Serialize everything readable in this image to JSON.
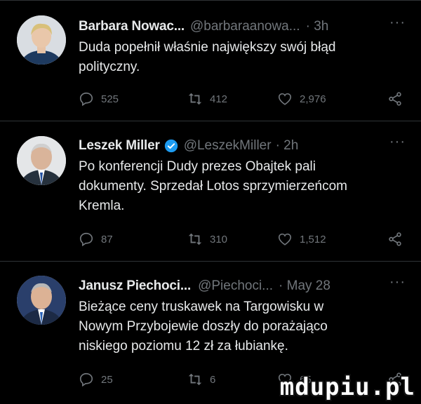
{
  "tweets": [
    {
      "name": "Barbara Nowac...",
      "handle": "@barbaraanowa...",
      "time": "· 3h",
      "more": "···",
      "verified": false,
      "text": "Duda popełnił właśnie największy swój błąd\npolityczny.",
      "replies": "525",
      "retweets": "412",
      "likes": "2,976"
    },
    {
      "name": "Leszek Miller",
      "handle": "@LeszekMiller",
      "time": "· 2h",
      "more": "···",
      "verified": true,
      "text": "Po konferencji Dudy prezes Obajtek pali\ndokumenty. Sprzedał Lotos sprzymierzeńcom\nKremla.",
      "replies": "87",
      "retweets": "310",
      "likes": "1,512"
    },
    {
      "name": "Janusz Piechoci...",
      "handle": "@Piechoci...",
      "time": "· May 28",
      "more": "···",
      "verified": false,
      "text": "Bieżące ceny truskawek na Targowisku w\nNowym Przybojewie doszły do porażająco\nniskiego poziomu 12 zł za łubiankę.",
      "replies": "25",
      "retweets": "6",
      "likes": "65"
    }
  ],
  "icons": {
    "reply": "reply-icon",
    "retweet": "retweet-icon",
    "like": "heart-icon",
    "share": "share-icon",
    "verified": "verified-badge-icon"
  },
  "colors": {
    "background": "#000000",
    "text": "#e7e9ea",
    "muted": "#71767b",
    "verified": "#1d9bf0",
    "divider": "#2f3336"
  },
  "watermark": "mdupiu.pl"
}
